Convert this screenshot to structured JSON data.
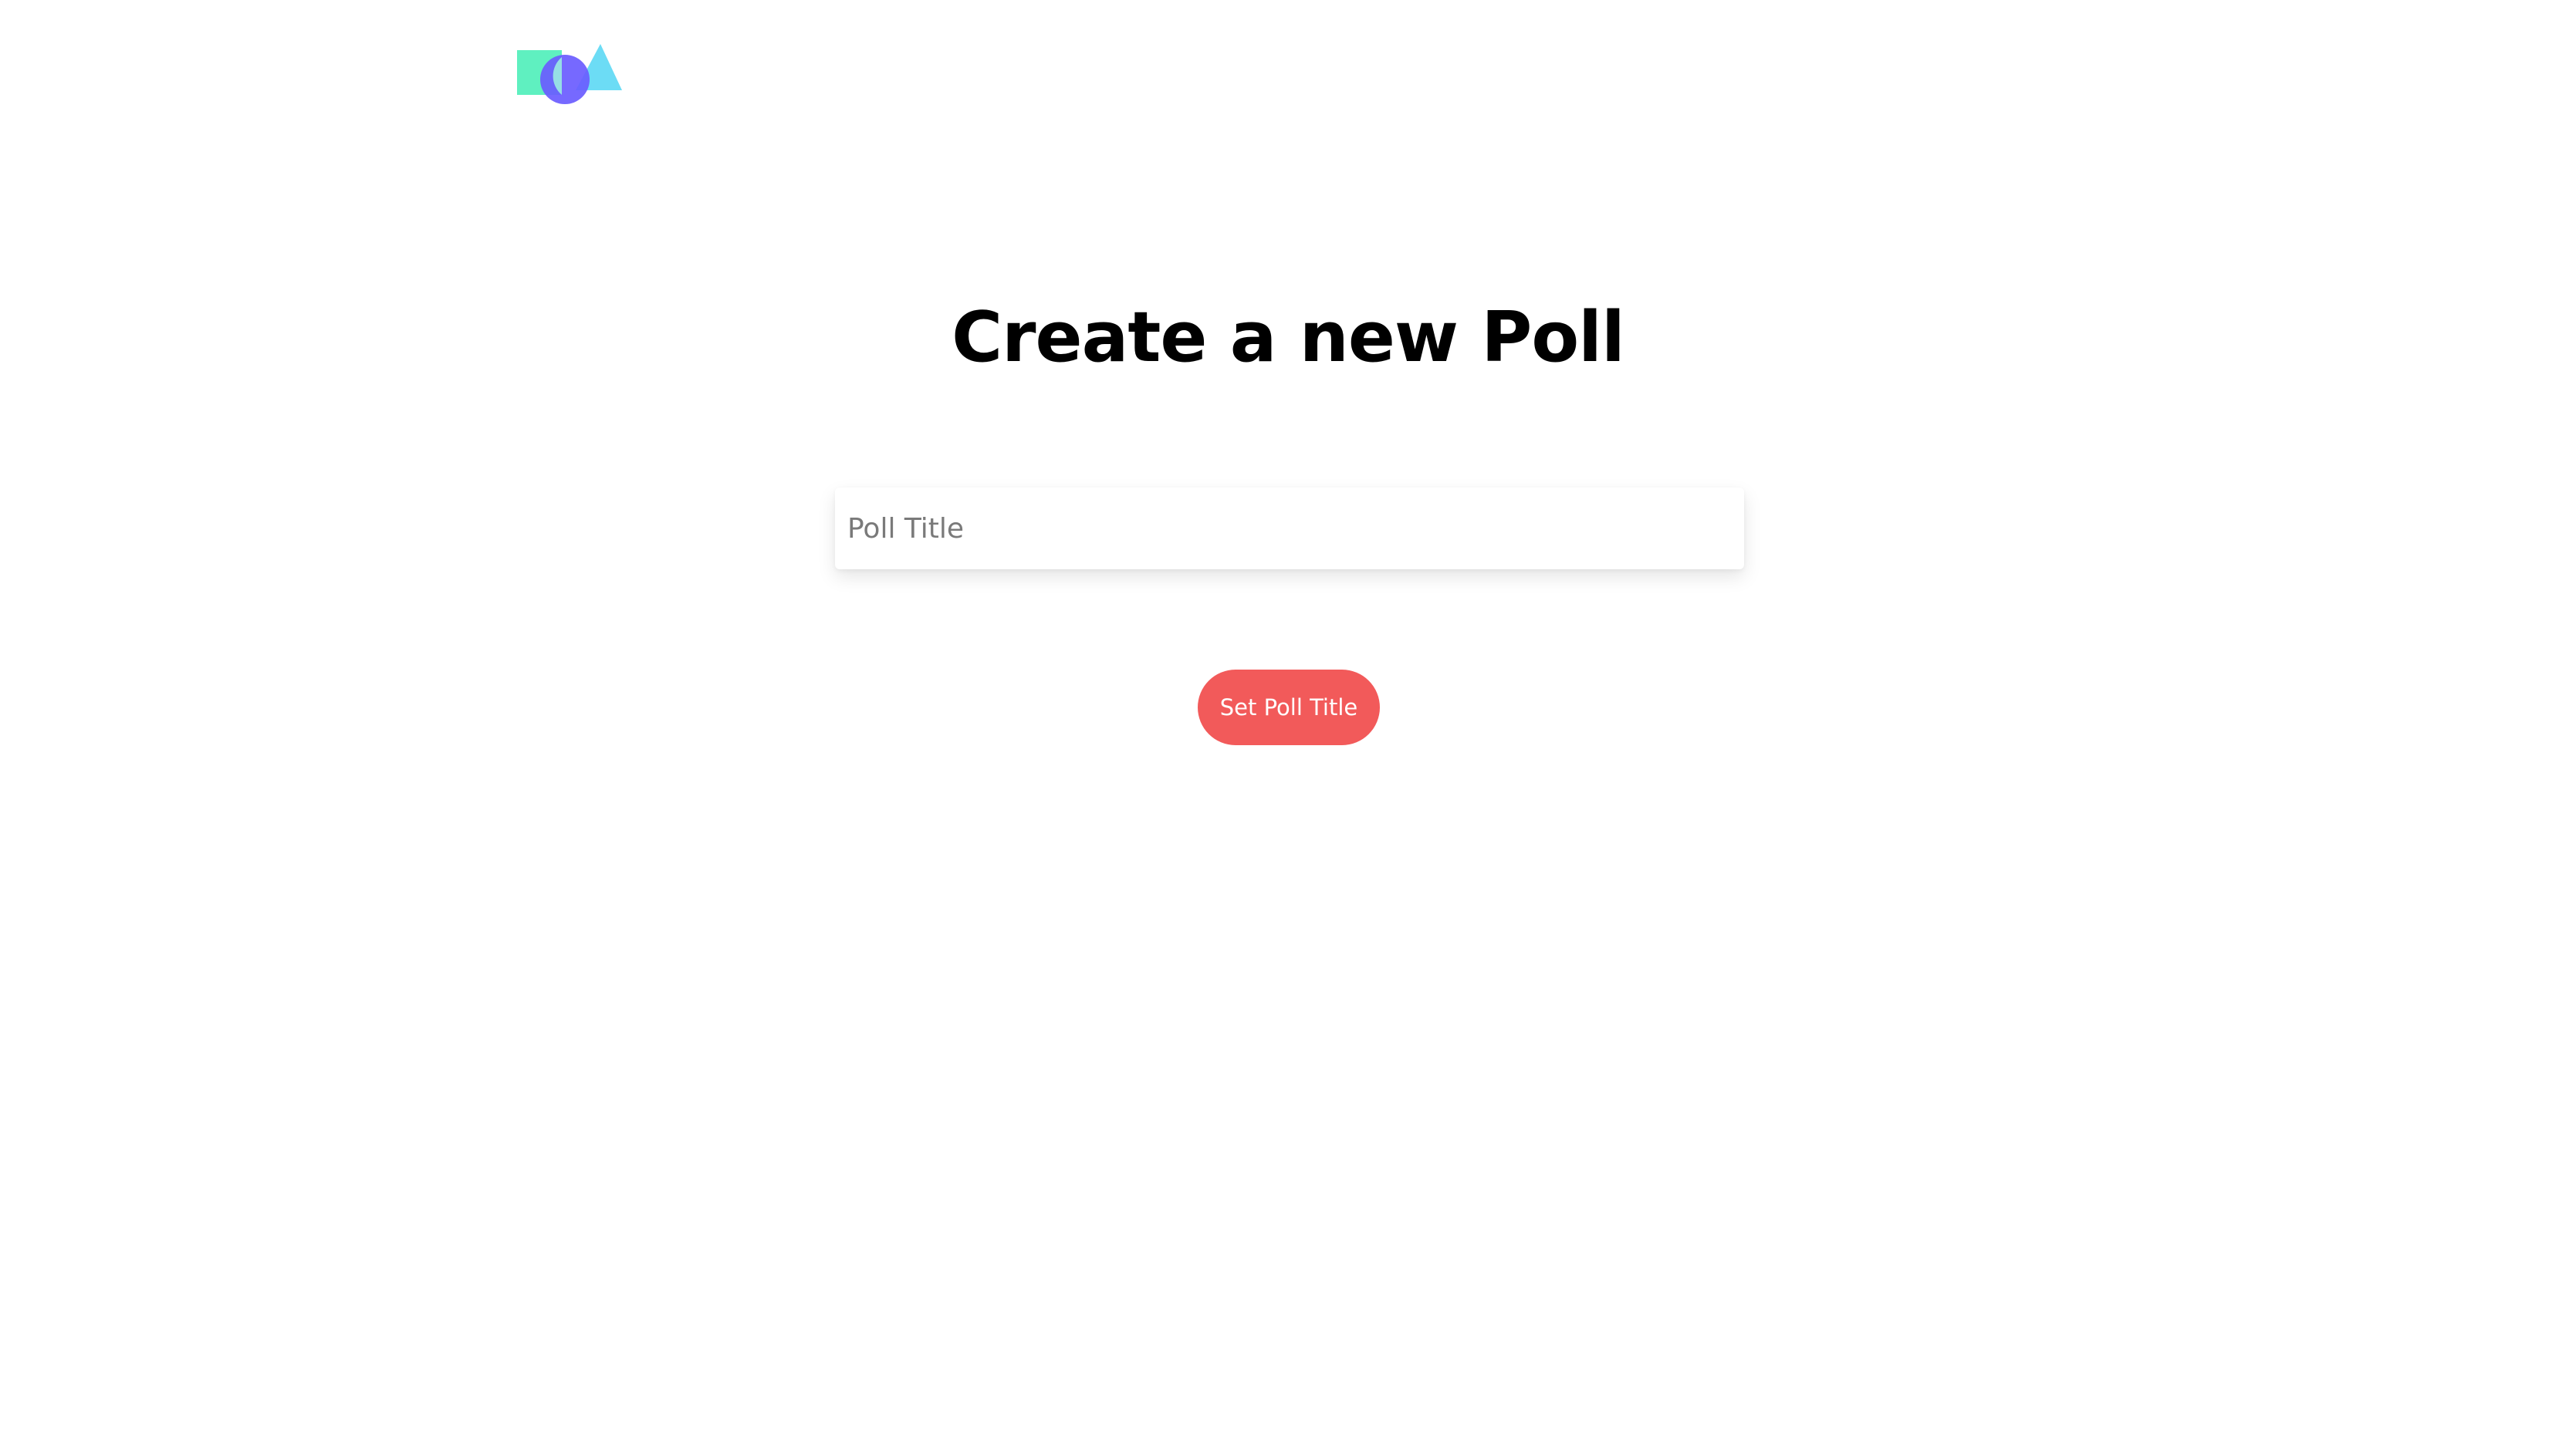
{
  "header": {
    "logo_icon": "shapes-logo-icon",
    "logo_colors": {
      "square": "#5ff0c0",
      "circle": "#6a5cff",
      "triangle": "#6cdcf5"
    }
  },
  "main": {
    "title": "Create a new Poll",
    "poll_title_input": {
      "placeholder": "Poll Title",
      "value": ""
    },
    "submit_label": "Set Poll Title"
  },
  "colors": {
    "background": "#ffffff",
    "title_text": "#000000",
    "button_bg": "#f25a5a",
    "button_text": "#ffffff",
    "placeholder_text": "#7a7a7a"
  }
}
